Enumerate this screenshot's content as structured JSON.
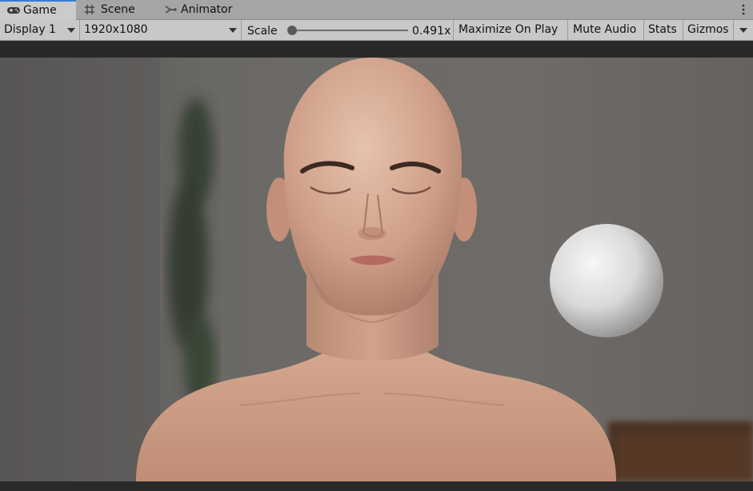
{
  "tabs": [
    {
      "label": "Game",
      "icon": "gamepad-icon",
      "active": true
    },
    {
      "label": "Scene",
      "icon": "grid-icon",
      "active": false
    },
    {
      "label": "Animator",
      "icon": "animator-icon",
      "active": false
    }
  ],
  "toolbar": {
    "display": "Display 1",
    "resolution": "1920x1080",
    "scale_label": "Scale",
    "scale_value": "0.491x",
    "scale_fraction": 0.0,
    "maximize": "Maximize On Play",
    "mute": "Mute Audio",
    "stats": "Stats",
    "gizmos": "Gizmos"
  },
  "colors": {
    "tab_accent": "#3a79d8",
    "tabbar_bg": "#a5a5a5",
    "toolbar_bg": "#c8c8c8",
    "viewport_gap": "#282828"
  }
}
